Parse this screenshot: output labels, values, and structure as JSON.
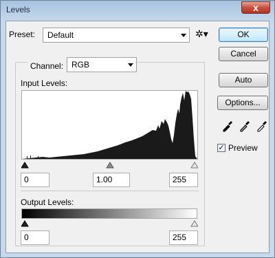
{
  "window": {
    "title": "Levels",
    "close_glyph": "x"
  },
  "preset": {
    "label": "Preset:",
    "value": "Default",
    "options_icon": "gear-icon"
  },
  "buttons": {
    "ok": "OK",
    "cancel": "Cancel",
    "auto": "Auto",
    "options": "Options..."
  },
  "channel": {
    "label": "Channel:",
    "value": "RGB"
  },
  "input_levels": {
    "label": "Input Levels:",
    "black": "0",
    "gamma": "1.00",
    "white": "255"
  },
  "output_levels": {
    "label": "Output Levels:",
    "black": "0",
    "white": "255"
  },
  "preview": {
    "label": "Preview",
    "checked": true
  },
  "eyedroppers": [
    "black-point-eyedropper-icon",
    "gray-point-eyedropper-icon",
    "white-point-eyedropper-icon"
  ]
}
